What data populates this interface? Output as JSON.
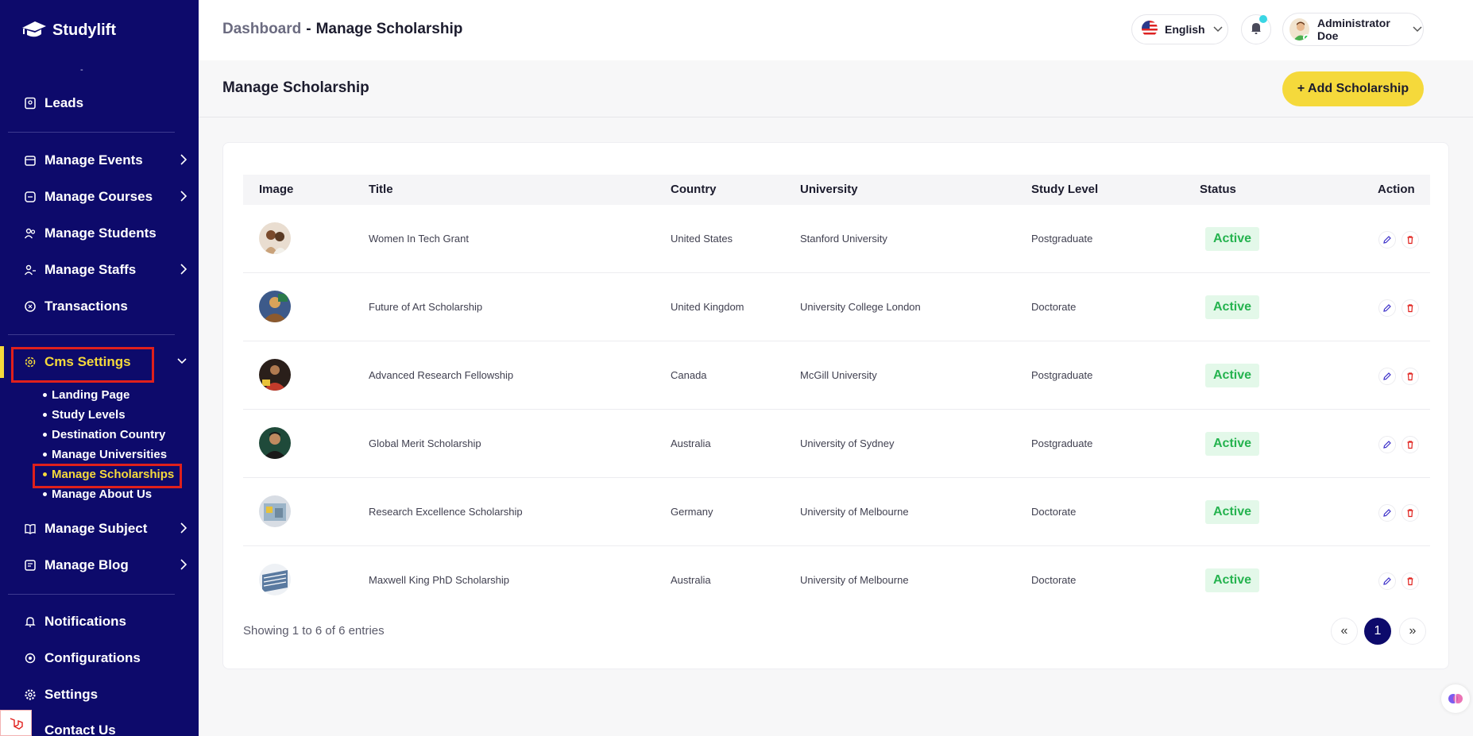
{
  "sidebar": {
    "brand": "Studylift",
    "dash_mark": "-",
    "items": [
      {
        "label": "Leads"
      },
      {
        "label": "Manage Events"
      },
      {
        "label": "Manage Courses"
      },
      {
        "label": "Manage Students"
      },
      {
        "label": "Manage Staffs"
      },
      {
        "label": "Transactions"
      },
      {
        "label": "Cms Settings"
      },
      {
        "label": "Manage Subject"
      },
      {
        "label": "Manage Blog"
      },
      {
        "label": "Notifications"
      },
      {
        "label": "Configurations"
      },
      {
        "label": "Settings"
      },
      {
        "label": "Contact Us"
      }
    ],
    "cms_sub": [
      {
        "label": "Landing Page"
      },
      {
        "label": "Study Levels"
      },
      {
        "label": "Destination Country"
      },
      {
        "label": "Manage Universities"
      },
      {
        "label": "Manage Scholarships"
      },
      {
        "label": "Manage About Us"
      }
    ]
  },
  "header": {
    "crumb_root": "Dashboard",
    "crumb_sep": "-",
    "crumb_current": "Manage Scholarship",
    "language": "English",
    "user_name": "Administrator Doe"
  },
  "page": {
    "title": "Manage Scholarship",
    "add_button": "+ Add Scholarship"
  },
  "table": {
    "columns": [
      "Image",
      "Title",
      "Country",
      "University",
      "Study Level",
      "Status",
      "Action"
    ],
    "rows": [
      {
        "title": "Women In Tech Grant",
        "country": "United States",
        "university": "Stanford University",
        "level": "Postgraduate",
        "status": "Active"
      },
      {
        "title": "Future of Art Scholarship",
        "country": "United Kingdom",
        "university": "University College London",
        "level": "Doctorate",
        "status": "Active"
      },
      {
        "title": "Advanced Research Fellowship",
        "country": "Canada",
        "university": "McGill University",
        "level": "Postgraduate",
        "status": "Active"
      },
      {
        "title": "Global Merit Scholarship",
        "country": "Australia",
        "university": "University of Sydney",
        "level": "Postgraduate",
        "status": "Active"
      },
      {
        "title": "Research Excellence Scholarship",
        "country": "Germany",
        "university": "University of Melbourne",
        "level": "Doctorate",
        "status": "Active"
      },
      {
        "title": "Maxwell King PhD Scholarship",
        "country": "Australia",
        "university": "University of Melbourne",
        "level": "Doctorate",
        "status": "Active"
      }
    ],
    "footer": "Showing 1 to 6 of 6 entries",
    "pagination": {
      "prev": "«",
      "current": "1",
      "next": "»"
    }
  },
  "colors": {
    "sidebar": "#0d0a6b",
    "accent": "#f5d93b",
    "active_badge": "#25b34f",
    "highlight": "#e0201c"
  }
}
